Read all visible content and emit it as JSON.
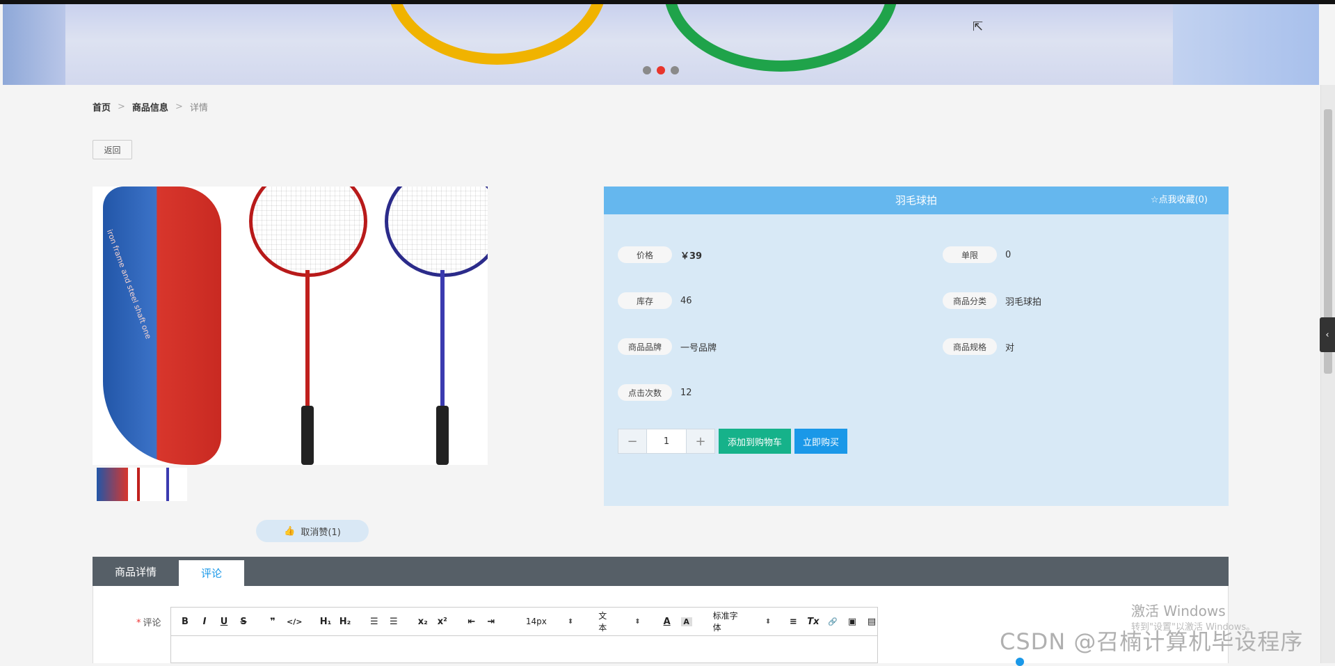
{
  "banner": {
    "dots": 3,
    "active_dot": 2
  },
  "breadcrumb": {
    "home": "首页",
    "product_info": "商品信息",
    "current": "详情",
    "sep": ">"
  },
  "back_label": "返回",
  "product": {
    "title": "羽毛球拍",
    "favorite": "☆点我收藏(0)",
    "bag_text": "iron frame and steel shaft one",
    "fields": {
      "price_label": "价格",
      "price_value": "￥39",
      "limit_label": "单限",
      "limit_value": "0",
      "stock_label": "库存",
      "stock_value": "46",
      "category_label": "商品分类",
      "category_value": "羽毛球拍",
      "brand_label": "商品品牌",
      "brand_value": "一号品牌",
      "spec_label": "商品规格",
      "spec_value": "对",
      "clicks_label": "点击次数",
      "clicks_value": "12"
    },
    "quantity": "1",
    "minus": "−",
    "plus": "+",
    "add_to_cart": "添加到购物车",
    "buy_now": "立即购买"
  },
  "like": {
    "icon": "thumbs-up-icon",
    "label": "取消赞(1)"
  },
  "tabs": [
    {
      "label": "商品详情"
    },
    {
      "label": "评论"
    }
  ],
  "comment": {
    "required_mark": "*",
    "label": "评论",
    "toolbar": {
      "bold": "B",
      "italic": "I",
      "underline": "U",
      "strike": "S",
      "quote": "❞",
      "code": "</>",
      "h1": "H₁",
      "h2": "H₂",
      "ol": "☰",
      "ul": "☰",
      "sub": "x₂",
      "sup": "x²",
      "indent_dec": "⇤",
      "indent_inc": "⇥",
      "size": "14px",
      "type": "文本",
      "font_color": "A",
      "bg_color": "A",
      "font": "标准字体",
      "align": "≡",
      "clear": "Tx",
      "link": "🔗",
      "image": "▣",
      "video": "▤",
      "arrow": "⬍"
    }
  },
  "watermark": {
    "line1": "激活 Windows",
    "line2": "转到\"设置\"以激活 Windows。",
    "csdn": "CSDN @召楠计算机毕设程序"
  }
}
